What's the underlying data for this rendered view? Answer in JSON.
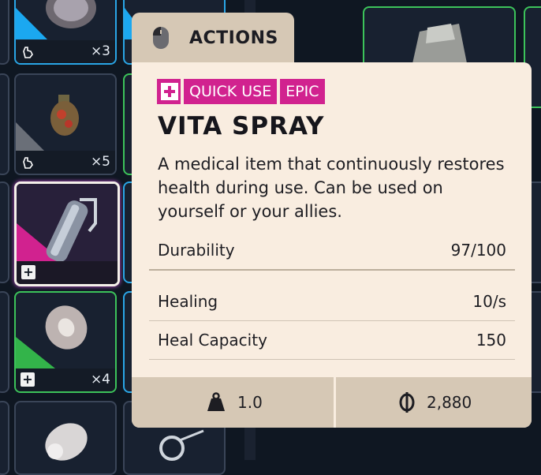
{
  "inventory": {
    "slots": [
      {
        "count": "×3"
      },
      {
        "count": "×5"
      },
      {
        "count": ""
      },
      {
        "count": "×4"
      }
    ]
  },
  "tooltip": {
    "tab_label": "ACTIONS",
    "tags": [
      "QUICK USE",
      "EPIC"
    ],
    "rarity_color": "#d1228f",
    "item_name": "VITA SPRAY",
    "description": "A medical item that continuously restores health during use. Can be used on yourself or your allies.",
    "stats": [
      {
        "label": "Durability",
        "value": "97/100"
      },
      {
        "label": "Healing",
        "value": "10/s"
      },
      {
        "label": "Heal Capacity",
        "value": "150"
      }
    ],
    "weight": "1.0",
    "price": "2,880",
    "icons": {
      "tab": "mouse-icon",
      "weight": "weight-icon",
      "price": "currency-icon",
      "tag": "plus-icon"
    }
  }
}
